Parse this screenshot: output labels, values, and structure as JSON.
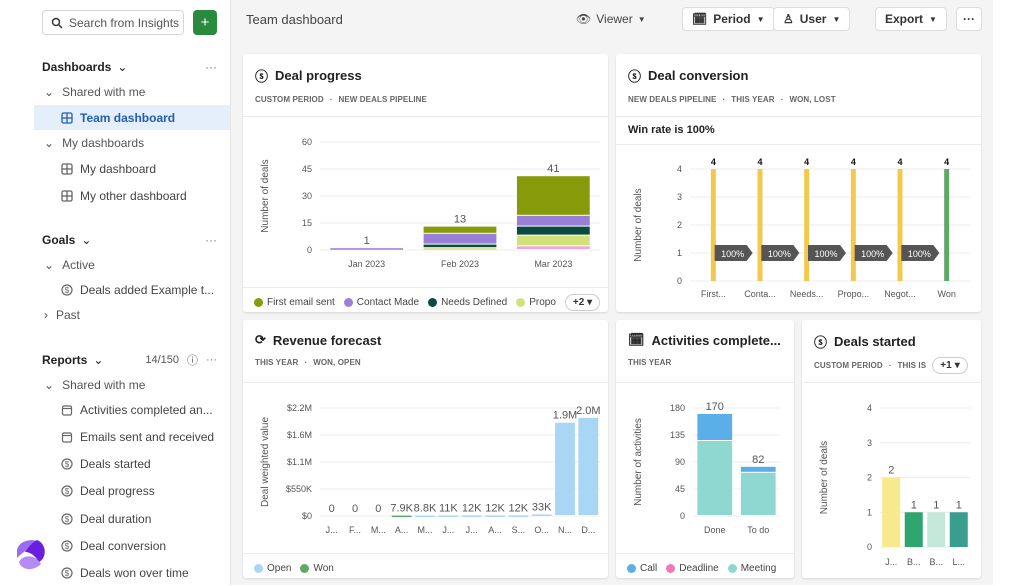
{
  "sidebar": {
    "search_placeholder": "Search from Insights",
    "add_label": "+",
    "dashboards": {
      "title": "Dashboards",
      "more": "···",
      "groups": [
        {
          "label": "Shared with me",
          "items": [
            {
              "label": "Team dashboard",
              "active": true
            }
          ]
        },
        {
          "label": "My dashboards",
          "items": [
            {
              "label": "My dashboard"
            },
            {
              "label": "My other dashboard"
            }
          ]
        }
      ]
    },
    "goals": {
      "title": "Goals",
      "more": "···",
      "active_label": "Active",
      "items": [
        {
          "label": "Deals added Example t..."
        }
      ],
      "past_label": "Past"
    },
    "reports": {
      "title": "Reports",
      "count": "14/150",
      "more": "···",
      "group_label": "Shared with me",
      "items": [
        {
          "label": "Activities completed an...",
          "icon": "calendar"
        },
        {
          "label": "Emails sent and received",
          "icon": "calendar"
        },
        {
          "label": "Deals started",
          "icon": "dollar"
        },
        {
          "label": "Deal progress",
          "icon": "dollar"
        },
        {
          "label": "Deal duration",
          "icon": "dollar"
        },
        {
          "label": "Deal conversion",
          "icon": "dollar"
        },
        {
          "label": "Deals won over time",
          "icon": "dollar"
        }
      ]
    }
  },
  "topbar": {
    "title": "Team dashboard",
    "viewer": "Viewer",
    "period": "Period",
    "user": "User",
    "export": "Export",
    "more": "···"
  },
  "cards": {
    "deal_progress": {
      "title": "Deal progress",
      "filters": [
        "CUSTOM PERIOD",
        "NEW DEALS PIPELINE"
      ],
      "more_legend": "+2"
    },
    "deal_conversion": {
      "title": "Deal conversion",
      "filters": [
        "NEW DEALS PIPELINE",
        "THIS YEAR",
        "WON, LOST"
      ],
      "win_rate": "Win rate is 100%"
    },
    "revenue_forecast": {
      "title": "Revenue forecast",
      "filters": [
        "THIS YEAR",
        "WON, OPEN"
      ]
    },
    "activities": {
      "title": "Activities complete...",
      "filters": [
        "THIS YEAR"
      ]
    },
    "deals_started": {
      "title": "Deals started",
      "filters": [
        "CUSTOM PERIOD",
        "THIS IS"
      ],
      "more_filters": "+1"
    }
  },
  "chart_data": [
    {
      "id": "deal_progress",
      "type": "bar",
      "stacked": true,
      "ylabel": "Number of deals",
      "ylim": [
        0,
        60
      ],
      "yticks": [
        0,
        15,
        30,
        45,
        60
      ],
      "ytick_labels": [
        "0",
        "15",
        "30",
        "45",
        "60"
      ],
      "categories": [
        "Jan 2023",
        "Feb 2023",
        "Mar 2023"
      ],
      "totals": [
        "1",
        "13",
        "41"
      ],
      "series": [
        {
          "name": "",
          "color": "#e9a6e0",
          "values": [
            0,
            0,
            2
          ]
        },
        {
          "name": "Propo",
          "color": "#d4e07a",
          "values": [
            0,
            1,
            6
          ]
        },
        {
          "name": "Needs Defined",
          "color": "#0b4a40",
          "values": [
            0,
            2,
            5
          ]
        },
        {
          "name": "Contact Made",
          "color": "#9a7fd6",
          "values": [
            1,
            6,
            6
          ]
        },
        {
          "name": "First email sent",
          "color": "#879a0a",
          "values": [
            0,
            4,
            22
          ]
        }
      ],
      "legend": [
        "First email sent",
        "Contact Made",
        "Needs Defined",
        "Propo"
      ]
    },
    {
      "id": "deal_conversion",
      "type": "bar",
      "ylabel": "Number of deals",
      "ylim": [
        0,
        4
      ],
      "yticks": [
        0,
        1,
        2,
        3,
        4
      ],
      "ytick_labels": [
        "0",
        "1",
        "2",
        "3",
        "4"
      ],
      "categories": [
        "First...",
        "Conta...",
        "Needs...",
        "Propo...",
        "Negot...",
        "Won"
      ],
      "totals": [
        "4",
        "4",
        "4",
        "4",
        "4",
        "4"
      ],
      "series": [
        {
          "name": "",
          "values": [
            4,
            4,
            4,
            4,
            4,
            4
          ],
          "colors": [
            "#f2c94c",
            "#f2c94c",
            "#f2c94c",
            "#f2c94c",
            "#f2c94c",
            "#5fa86a"
          ]
        }
      ],
      "conversion_rates": [
        "100%",
        "100%",
        "100%",
        "100%",
        "100%"
      ]
    },
    {
      "id": "revenue_forecast",
      "type": "bar",
      "stacked": true,
      "ylabel": "Deal weighted value",
      "ylim": [
        0,
        2200000
      ],
      "yticks": [
        0,
        550000,
        1100000,
        1650000,
        2200000
      ],
      "ytick_labels": [
        "$0",
        "$550K",
        "$1.1M",
        "$1.6M",
        "$2.2M"
      ],
      "categories": [
        "J...",
        "F...",
        "M...",
        "A...",
        "M...",
        "J...",
        "J...",
        "A...",
        "S...",
        "O...",
        "N...",
        "D..."
      ],
      "totals": [
        "0",
        "0",
        "0",
        "7.9K",
        "8.8K",
        "11K",
        "12K",
        "12K",
        "12K",
        "33K",
        "1.9M",
        "2.0M"
      ],
      "series": [
        {
          "name": "Won",
          "color": "#5fa86a",
          "values": [
            0,
            0,
            0,
            7900,
            0,
            0,
            0,
            0,
            0,
            0,
            0,
            0
          ]
        },
        {
          "name": "Open",
          "color": "#a9d6f5",
          "values": [
            0,
            0,
            0,
            0,
            8800,
            11000,
            12000,
            12000,
            12000,
            33000,
            1900000,
            2000000
          ]
        }
      ],
      "legend": [
        "Open",
        "Won"
      ]
    },
    {
      "id": "activities",
      "type": "bar",
      "stacked": true,
      "ylabel": "Number of activities",
      "ylim": [
        0,
        180
      ],
      "yticks": [
        0,
        45,
        90,
        135,
        180
      ],
      "ytick_labels": [
        "0",
        "45",
        "90",
        "135",
        "180"
      ],
      "categories": [
        "Done",
        "To do"
      ],
      "totals": [
        "170",
        "82"
      ],
      "series": [
        {
          "name": "Meeting",
          "color": "#8fd8d2",
          "values": [
            125,
            72
          ]
        },
        {
          "name": "Deadline",
          "color": "#f07ab5",
          "values": [
            0,
            0
          ]
        },
        {
          "name": "Call",
          "color": "#5aafe8",
          "values": [
            45,
            10
          ]
        }
      ],
      "legend": [
        "Call",
        "Deadline",
        "Meeting"
      ]
    },
    {
      "id": "deals_started",
      "type": "bar",
      "ylabel": "Number of deals",
      "ylim": [
        0,
        4
      ],
      "yticks": [
        0,
        1,
        2,
        3,
        4
      ],
      "ytick_labels": [
        "0",
        "1",
        "2",
        "3",
        "4"
      ],
      "categories": [
        "J...",
        "B...",
        "B...",
        "L..."
      ],
      "totals": [
        "2",
        "1",
        "1",
        "1"
      ],
      "series": [
        {
          "name": "",
          "values": [
            2,
            1,
            1,
            1
          ],
          "colors": [
            "#f6e98e",
            "#2fa56f",
            "#c4e8da",
            "#3a9e8f"
          ]
        }
      ]
    }
  ]
}
